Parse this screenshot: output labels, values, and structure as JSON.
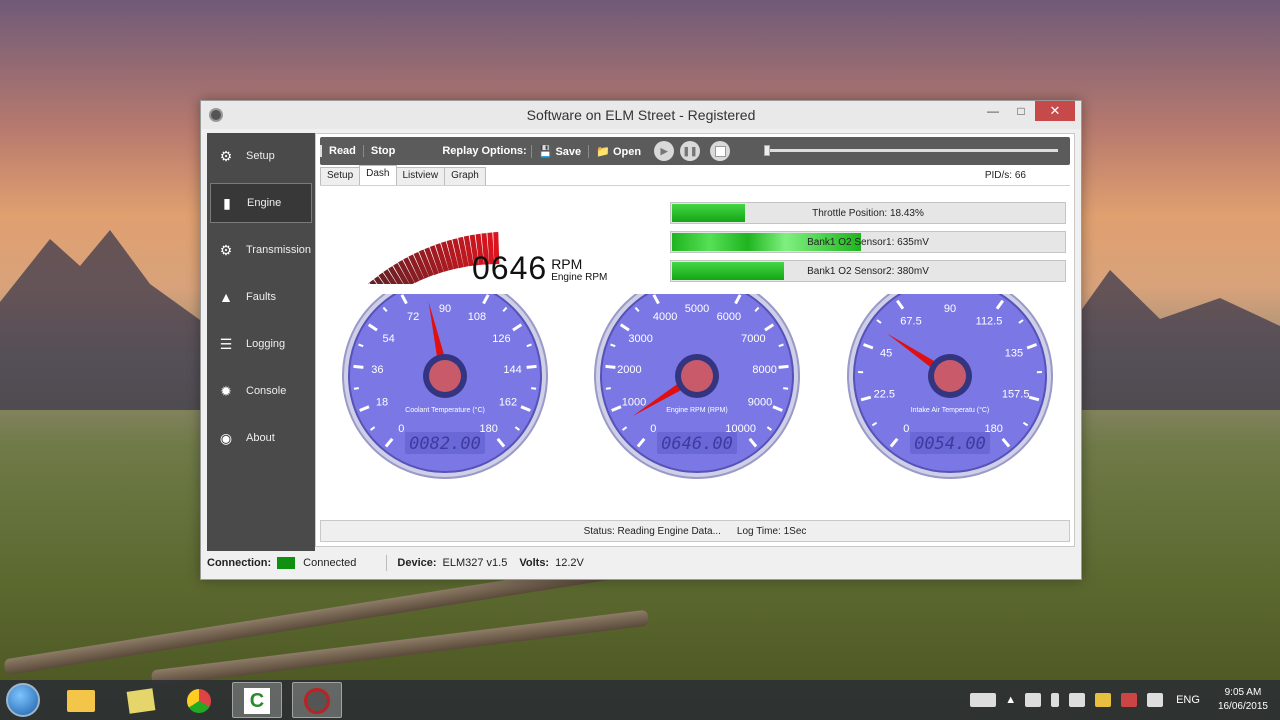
{
  "window": {
    "title": "Software on ELM Street - Registered"
  },
  "sidebar": {
    "items": [
      {
        "label": "Setup",
        "icon": "gears-icon"
      },
      {
        "label": "Engine",
        "icon": "engine-icon"
      },
      {
        "label": "Transmission",
        "icon": "gear-icon"
      },
      {
        "label": "Faults",
        "icon": "warning-icon"
      },
      {
        "label": "Logging",
        "icon": "list-icon"
      },
      {
        "label": "Console",
        "icon": "console-icon"
      },
      {
        "label": "About",
        "icon": "chat-icon"
      }
    ]
  },
  "toolbar": {
    "read_label": "Read",
    "stop_label": "Stop",
    "replay_label": "Replay Options:",
    "save_label": "Save",
    "open_label": "Open",
    "replay_progress": 0
  },
  "tabs": [
    "Setup",
    "Dash",
    "Listview",
    "Graph"
  ],
  "active_tab": "Dash",
  "pids_label": "PID/s: 66",
  "rpm_display": {
    "value": "0646",
    "unit": "RPM",
    "name": "Engine RPM",
    "bar_level": 0.0646
  },
  "bars": [
    {
      "label": "Throttle Position: 18.43%",
      "fraction": 0.1843
    },
    {
      "label": "Bank1 O2 Sensor1: 635mV",
      "fraction": 0.48
    },
    {
      "label": "Bank1 O2 Sensor2: 380mV",
      "fraction": 0.285
    }
  ],
  "gauges": [
    {
      "title": "Coolant Temperature (°C)",
      "ticks": [
        "0",
        "18",
        "36",
        "54",
        "72",
        "90",
        "108",
        "126",
        "144",
        "162",
        "180"
      ],
      "min": 0,
      "max": 180,
      "value": 82,
      "readout": "0082.00"
    },
    {
      "title": "Engine RPM (RPM)",
      "ticks": [
        "0",
        "1000",
        "2000",
        "3000",
        "4000",
        "5000",
        "6000",
        "7000",
        "8000",
        "9000",
        "10000"
      ],
      "min": 0,
      "max": 10000,
      "value": 646,
      "readout": "0646.00"
    },
    {
      "title": "Intake Air Temperatu (°C)",
      "ticks": [
        "0",
        "22.5",
        "45",
        "67.5",
        "90",
        "112.5",
        "135",
        "157.5",
        "180"
      ],
      "min": 0,
      "max": 180,
      "value": 54,
      "readout": "0054.00"
    }
  ],
  "status": {
    "text": "Status: Reading Engine Data...",
    "log": "Log Time: 1Sec"
  },
  "bottom": {
    "connection_label": "Connection:",
    "connection_value": "Connected",
    "device_label": "Device:",
    "device_value": "ELM327 v1.5",
    "volts_label": "Volts:",
    "volts_value": "12.2V"
  },
  "taskbar": {
    "lang": "ENG",
    "time": "9:05 AM",
    "date": "16/06/2015"
  },
  "colors": {
    "gauge_face": "#7b78e6",
    "needle": "#e01010",
    "bar_fill": "#22b022",
    "close": "#c74a4a"
  }
}
